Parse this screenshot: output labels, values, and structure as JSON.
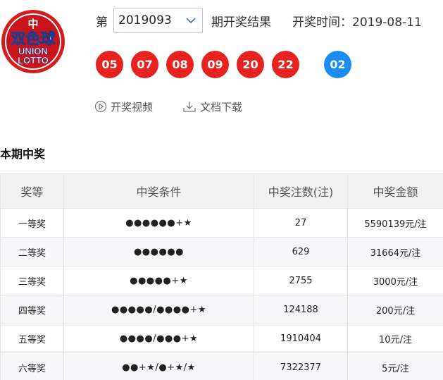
{
  "logo": {
    "main_text": "双色球",
    "sub_text_top": "UNION",
    "sub_text_bottom": "LOTTO",
    "top_mark": "中",
    "colors": {
      "outer": "#d61d1d",
      "inner": "#c8141a",
      "text": "#ffffff",
      "shadow": "#1a3c8f"
    }
  },
  "header": {
    "prefix": "第",
    "issue": "2019093",
    "result_label": "期开奖结果",
    "time_label": "开奖时间：2019-08-11"
  },
  "balls": {
    "red": [
      "05",
      "07",
      "08",
      "09",
      "20",
      "22"
    ],
    "blue": [
      "02"
    ],
    "colors": {
      "red": "#e8231f",
      "blue": "#1a8cf2"
    }
  },
  "links": [
    {
      "label": "开奖视频",
      "icon": "play-circle-icon"
    },
    {
      "label": "文档下载",
      "icon": "download-icon"
    }
  ],
  "section_title": "本期中奖",
  "table": {
    "headers": [
      "奖等",
      "中奖条件",
      "中奖注数(注)",
      "中奖金额"
    ],
    "rows": [
      {
        "level": "一等奖",
        "condition": "●●●●●●+★",
        "count": "27",
        "amount": "5590139元/注"
      },
      {
        "level": "二等奖",
        "condition": "●●●●●●",
        "count": "629",
        "amount": "31664元/注"
      },
      {
        "level": "三等奖",
        "condition": "●●●●●+★",
        "count": "2755",
        "amount": "3000元/注"
      },
      {
        "level": "四等奖",
        "condition": "●●●●●/●●●●+★",
        "count": "124188",
        "amount": "200元/注"
      },
      {
        "level": "五等奖",
        "condition": "●●●●/●●●+★",
        "count": "1910404",
        "amount": "10元/注"
      },
      {
        "level": "六等奖",
        "condition": "●●+★/●+★/★",
        "count": "7322377",
        "amount": "5元/注"
      }
    ]
  }
}
